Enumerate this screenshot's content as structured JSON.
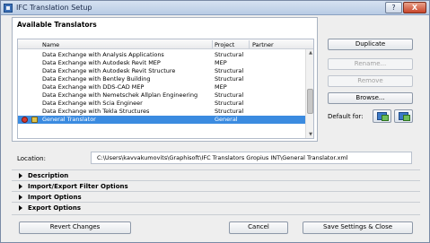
{
  "window": {
    "title": "IFC Translation Setup"
  },
  "titlebar": {
    "help_label": "?",
    "close_label": "X"
  },
  "group": {
    "title": "Available Translators"
  },
  "table": {
    "columns": [
      "Name",
      "Project",
      "Partner"
    ],
    "rows": [
      {
        "name": "Data Exchange with Analysis Applications",
        "project": "Structural",
        "partner": ""
      },
      {
        "name": "Data Exchange with Autodesk Revit MEP",
        "project": "MEP",
        "partner": ""
      },
      {
        "name": "Data Exchange with Autodesk Revit Structure",
        "project": "Structural",
        "partner": ""
      },
      {
        "name": "Data Exchange with Bentley Building",
        "project": "Structural",
        "partner": ""
      },
      {
        "name": "Data Exchange with DDS-CAD MEP",
        "project": "MEP",
        "partner": ""
      },
      {
        "name": "Data Exchange with Nemetschek Allplan Engineering",
        "project": "Structural",
        "partner": ""
      },
      {
        "name": "Data Exchange with Scia Engineer",
        "project": "Structural",
        "partner": ""
      },
      {
        "name": "Data Exchange with Tekla Structures",
        "project": "Structural",
        "partner": ""
      },
      {
        "name": "General Translator",
        "project": "General",
        "partner": ""
      }
    ],
    "selected_index": 8
  },
  "buttons": {
    "duplicate": "Duplicate",
    "rename": "Rename...",
    "remove": "Remove",
    "browse": "Browse...",
    "default_for": "Default for:",
    "revert": "Revert Changes",
    "cancel": "Cancel",
    "save": "Save Settings & Close"
  },
  "location": {
    "label": "Location:",
    "value": "C:\\Users\\kavvakumovits\\Graphisoft\\IFC Translators Gropius INT\\General Translator.xml"
  },
  "sections": [
    "Description",
    "Import/Export Filter Options",
    "Import Options",
    "Export Options"
  ],
  "colors": {
    "selection": "#3b8be0",
    "titlebar": "#c7d6ea",
    "close": "#c8452a"
  }
}
